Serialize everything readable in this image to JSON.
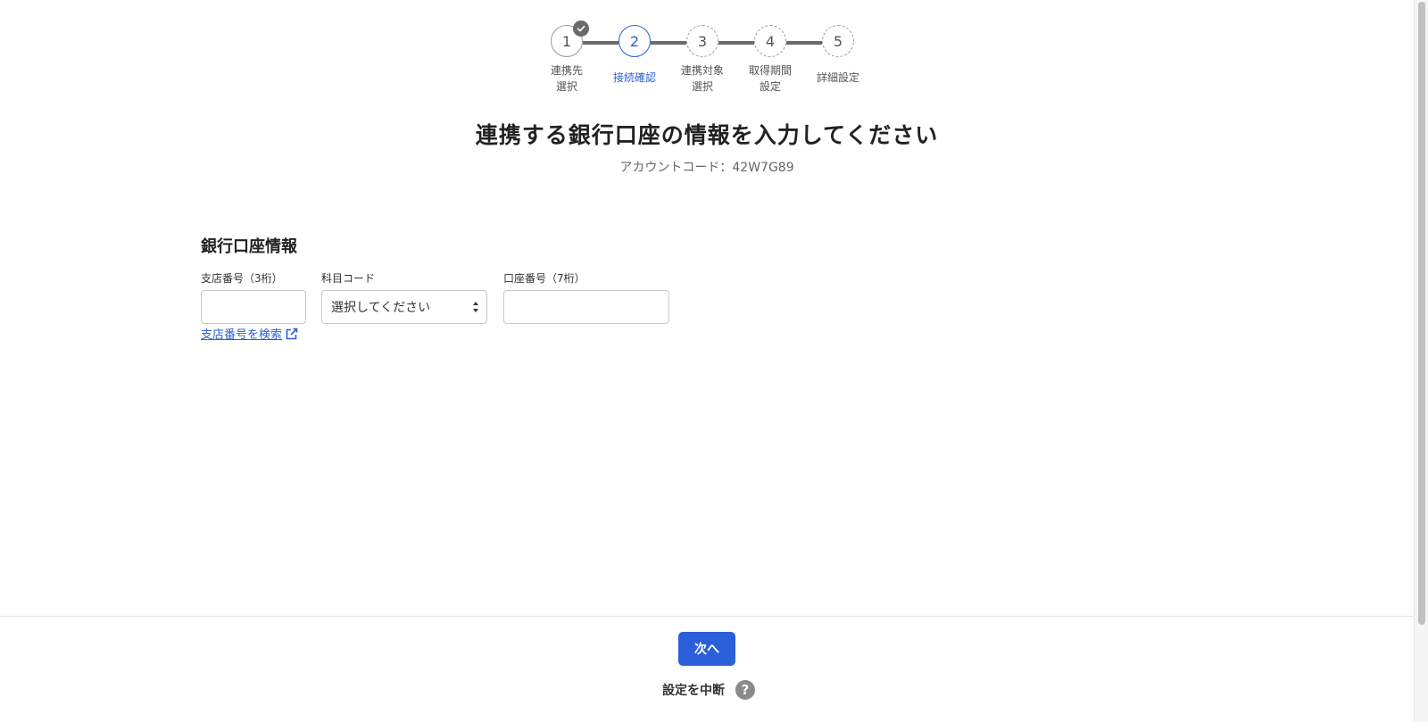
{
  "stepper": {
    "steps": [
      {
        "number": "1",
        "label": "連携先\n選択",
        "state": "done"
      },
      {
        "number": "2",
        "label": "接続確認",
        "state": "active"
      },
      {
        "number": "3",
        "label": "連携対象\n選択",
        "state": "pending"
      },
      {
        "number": "4",
        "label": "取得期間\n設定",
        "state": "pending"
      },
      {
        "number": "5",
        "label": "詳細設定",
        "state": "pending"
      }
    ]
  },
  "page": {
    "title": "連携する銀行口座の情報を入力してください",
    "account_code": "アカウントコード：42W7G89"
  },
  "form": {
    "section_title": "銀行口座情報",
    "branch_label": "支店番号（3桁）",
    "branch_value": "",
    "subject_label": "科目コード",
    "subject_selected": "選択してください",
    "account_label": "口座番号（7桁）",
    "account_value": "",
    "search_link": "支店番号を検索"
  },
  "footer": {
    "next_label": "次へ",
    "abort_label": "設定を中断",
    "help_symbol": "?"
  },
  "colors": {
    "accent": "#2b5fd9",
    "connector": "#6b6b6b",
    "text": "#333333"
  }
}
